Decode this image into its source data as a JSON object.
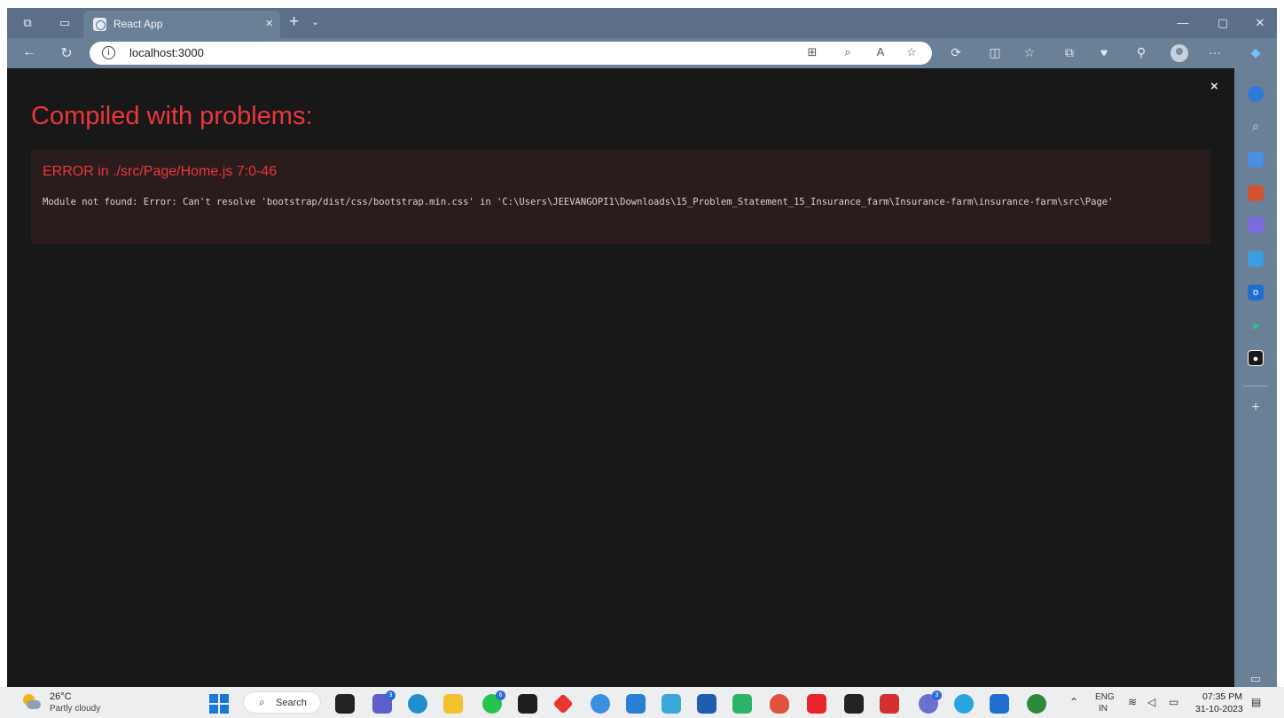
{
  "browser": {
    "tab_title": "React App",
    "new_tab_symbol": "+",
    "tab_close_symbol": "×",
    "tab_dropdown_symbol": "⌄",
    "url": "localhost:3000",
    "window_controls": {
      "minimize": "—",
      "maximize": "▢",
      "close": "✕"
    },
    "toolbar_icons": [
      "grid-icon",
      "zoom-icon",
      "read-aloud-icon",
      "favorite-star-icon",
      "extensions-icon",
      "split-screen-icon",
      "favorites-icon",
      "collections-icon",
      "browser-essentials-icon",
      "share-icon",
      "profile-icon",
      "more-icon",
      "copilot-icon"
    ]
  },
  "page": {
    "overlay_close": "×",
    "heading": "Compiled with problems:",
    "error": {
      "title": "ERROR in ./src/Page/Home.js 7:0-46",
      "message": "Module not found: Error: Can't resolve 'bootstrap/dist/css/bootstrap.min.css' in 'C:\\Users\\JEEVANGOPI1\\Downloads\\15_Problem_Statement_15_Insurance_farm\\Insurance-farm\\insurance-farm\\src\\Page'"
    }
  },
  "sidebar": {
    "icons": [
      "search-icon",
      "shopping-tag-icon",
      "tools-icon",
      "games-icon",
      "microsoft-365-icon",
      "outlook-icon",
      "send-icon",
      "github-icon",
      "add-icon",
      "sidebar-toggle-icon"
    ]
  },
  "taskbar": {
    "weather": {
      "temperature": "26°C",
      "condition": "Partly cloudy"
    },
    "search_label": "Search",
    "badges": {
      "teams": "3",
      "whatsapp": "6",
      "teams2": "3"
    },
    "language": {
      "line1": "ENG",
      "line2": "IN"
    },
    "clock": {
      "time": "07:35 PM",
      "date": "31-10-2023"
    }
  },
  "colors": {
    "error_red": "#e8383c",
    "page_background": "#181818",
    "error_box": "#2a1b1d",
    "browser_chrome": "#6a8097"
  }
}
